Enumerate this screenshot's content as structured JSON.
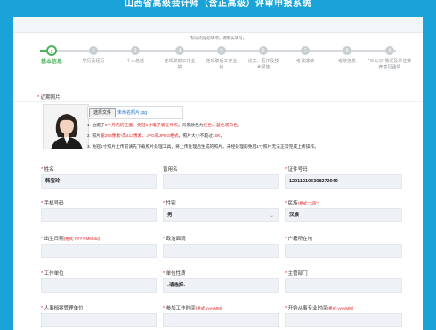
{
  "site": {
    "title": "山西省高级会计师（含正高级）评审申报系统"
  },
  "hint": {
    "star": "*",
    "text": "标记的是必填项，请如实填写。"
  },
  "steps": [
    {
      "num": "1",
      "label": "基本信息"
    },
    {
      "num": "2",
      "label": "学历及经历"
    },
    {
      "num": "3",
      "label": "个人总结"
    },
    {
      "num": "4",
      "label": "任现职前工作业绩"
    },
    {
      "num": "5",
      "label": "任现职后工作业绩"
    },
    {
      "num": "6",
      "label": "论文、著作及技术报告"
    },
    {
      "num": "7",
      "label": "考试成绩"
    },
    {
      "num": "8",
      "label": "考核信息"
    },
    {
      "num": "9",
      "label": "\"三公示\"情况及单位推荐意见函情"
    }
  ],
  "photo": {
    "label": "近期照片",
    "button": "选择文件",
    "filename": "未命名照片.jpg",
    "rules": [
      {
        "prefix": "1. 拍摄于",
        "red1": "6个月内的正面、免冠1寸电子版证件照",
        "mid": "。背景颜色为",
        "red2": "红色、蓝色或白色",
        "suffix": "。"
      },
      {
        "prefix": "2. 照片",
        "red1": "宽295像素*高413像素、JPG或JPEG格式",
        "mid": "，照片大小不超过",
        "red2": "10K",
        "suffix": "。"
      },
      {
        "prefix": "3. 免冠1寸照片上传前请先下载照片处理工具，将上传处理后生成的照片，未经处理的免冠1寸照片无法正常完成上传操作。",
        "red1": "",
        "mid": "",
        "red2": "",
        "suffix": ""
      }
    ]
  },
  "fields": {
    "name": {
      "label": "姓名",
      "value": "韩宝玲"
    },
    "former_name": {
      "label": "曾用名",
      "value": ""
    },
    "id_number": {
      "label": "证件号码",
      "value": "120112196308272949"
    },
    "phone": {
      "label": "手机号码",
      "value": ""
    },
    "gender": {
      "label": "性别",
      "value": "男"
    },
    "ethnicity": {
      "label": "民族",
      "fmt": "(格式:\"X族\")",
      "value": "汉族"
    },
    "birth_date": {
      "label": "出生日期",
      "fmt": "(格式:YYYY-MM-dd)",
      "value": ""
    },
    "political": {
      "label": "政治面貌",
      "value": ""
    },
    "hukou": {
      "label": "户籍所在地",
      "value": ""
    },
    "work_unit": {
      "label": "工作单位",
      "value": ""
    },
    "unit_nature": {
      "label": "单位性质",
      "value": "-请选择-"
    },
    "department": {
      "label": "主管部门",
      "value": ""
    },
    "archive_unit": {
      "label": "人事档案管理单位",
      "value": ""
    },
    "work_start": {
      "label": "参加工作时间",
      "fmt": "(格式:yyyyMM)",
      "value": ""
    },
    "profession_start": {
      "label": "开始从事专业时间",
      "fmt": "(格式:yyyyMM)",
      "value": ""
    }
  },
  "colors": {
    "header": "#1aa3d8",
    "active": "#4db25c",
    "required": "#e02424",
    "input_bg": "#eef2f6"
  }
}
